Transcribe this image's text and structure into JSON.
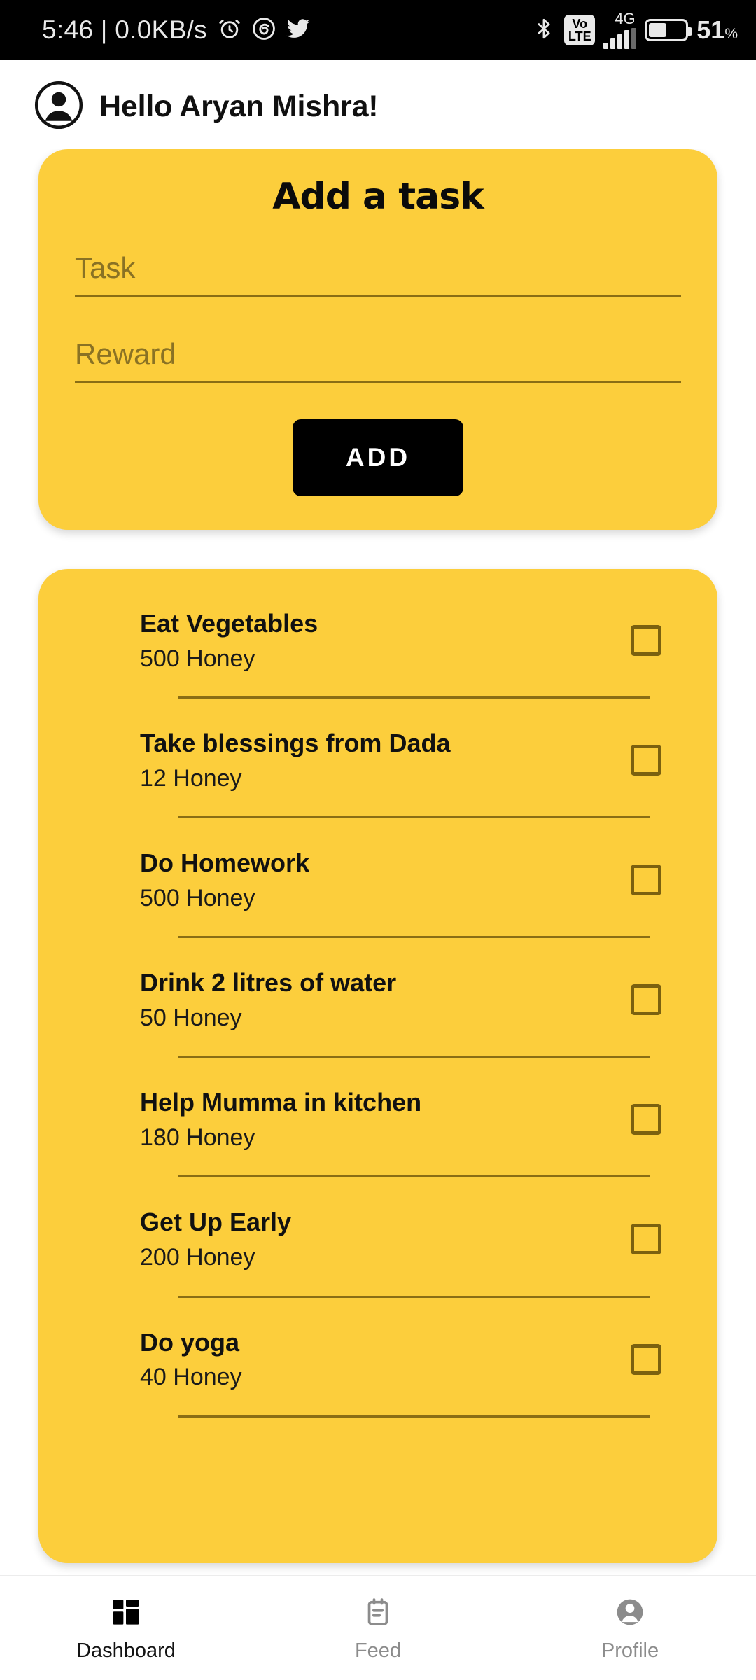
{
  "status_bar": {
    "clock_and_net": "5:46 | 0.0KB/s",
    "icons_left": [
      "alarm-clock-icon",
      "spiral-app-icon",
      "twitter-icon"
    ],
    "icons_right": [
      "bluetooth-icon",
      "volte-badge",
      "signal-4g-icon",
      "battery-icon"
    ],
    "volte_top": "Vo",
    "volte_bottom": "LTE",
    "network_type": "4G",
    "battery_percent": "51",
    "battery_percent_symbol": "%"
  },
  "header": {
    "avatar_icon": "account-circle-icon",
    "greeting": "Hello Aryan Mishra!"
  },
  "add_task_card": {
    "title": "Add a task",
    "task_field": {
      "value": "",
      "placeholder": "Task"
    },
    "reward_field": {
      "value": "",
      "placeholder": "Reward"
    },
    "add_button_label": "ADD"
  },
  "task_list": {
    "items": [
      {
        "title": "Eat Vegetables",
        "reward": "500 Honey",
        "checked": false
      },
      {
        "title": "Take blessings from Dada",
        "reward": "12 Honey",
        "checked": false
      },
      {
        "title": "Do Homework",
        "reward": "500 Honey",
        "checked": false
      },
      {
        "title": "Drink 2 litres of water",
        "reward": "50 Honey",
        "checked": false
      },
      {
        "title": "Help Mumma in kitchen",
        "reward": "180 Honey",
        "checked": false
      },
      {
        "title": "Get Up Early",
        "reward": "200 Honey",
        "checked": false
      },
      {
        "title": "Do yoga",
        "reward": "40 Honey",
        "checked": false
      }
    ]
  },
  "bottom_nav": {
    "items": [
      {
        "label": "Dashboard",
        "icon": "dashboard-grid-icon",
        "active": true
      },
      {
        "label": "Feed",
        "icon": "feed-note-icon",
        "active": false
      },
      {
        "label": "Profile",
        "icon": "profile-person-icon",
        "active": false
      }
    ]
  },
  "colors": {
    "card_yellow": "#FCCE3C",
    "page_background": "#FFFFFF",
    "status_bar_background": "#000000",
    "accent_dark": "#000000",
    "muted_olive": "#8A6D14",
    "checkbox_olive": "#7B610F",
    "inactive_nav": "#8C8C8C"
  }
}
